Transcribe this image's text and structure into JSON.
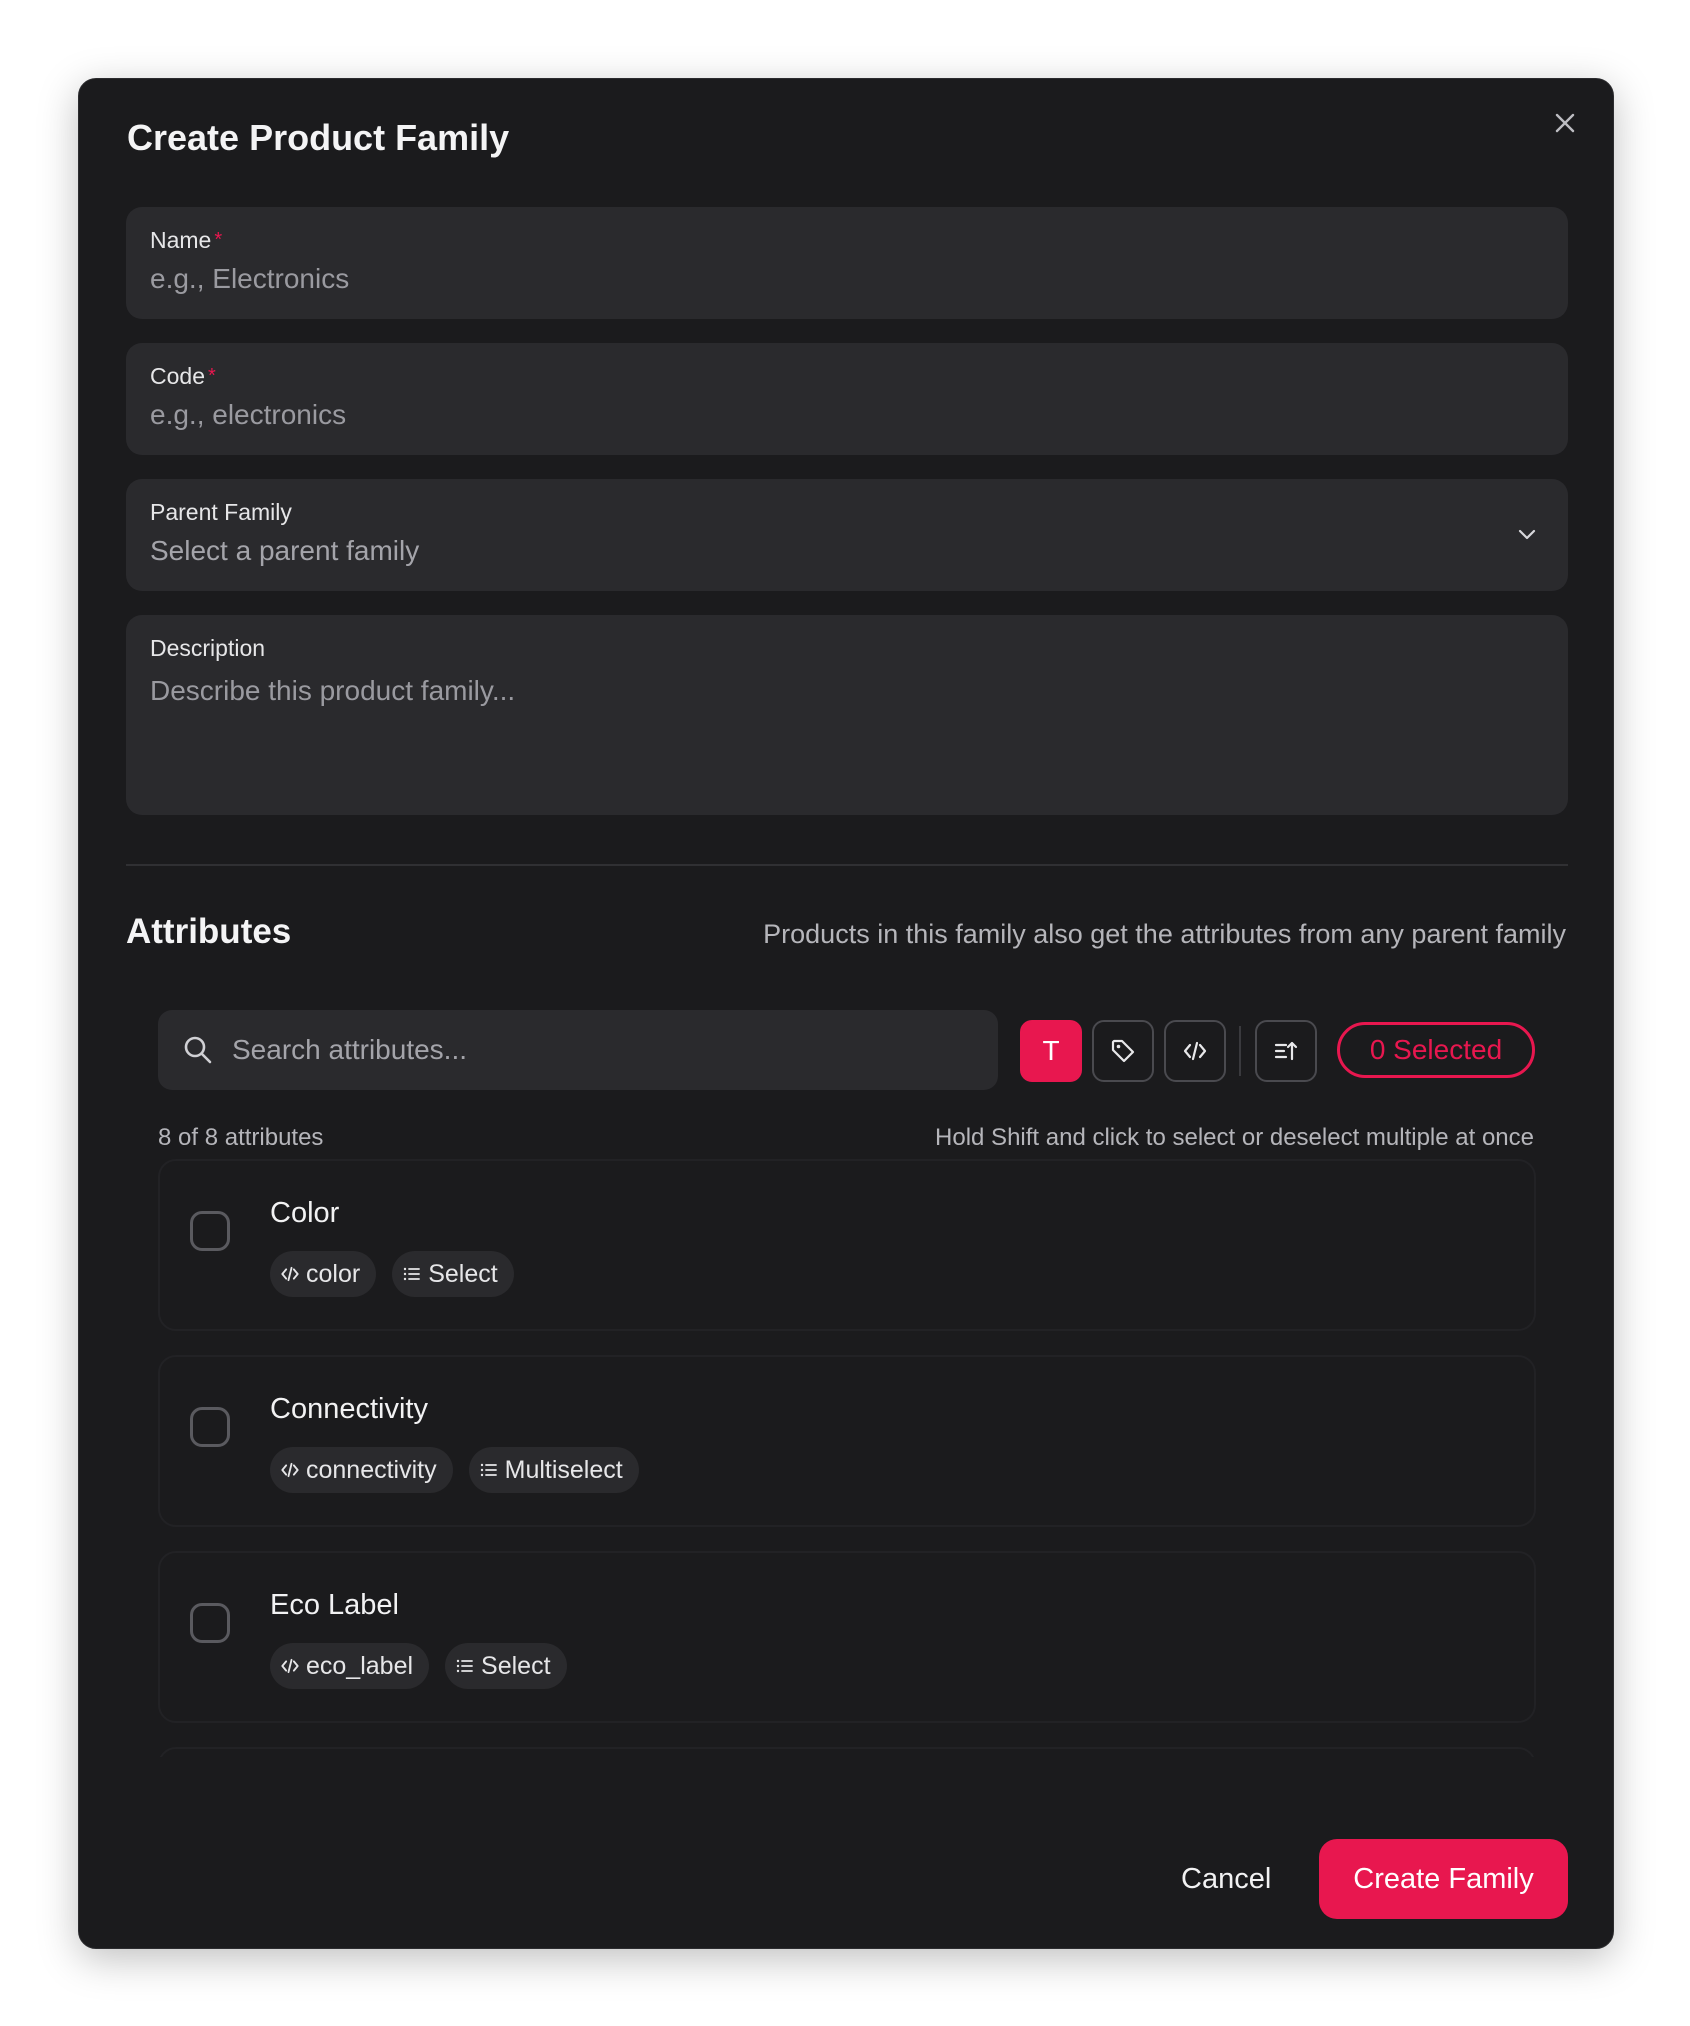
{
  "dialog": {
    "title": "Create Product Family",
    "close_icon": "close-icon"
  },
  "form": {
    "name": {
      "label": "Name",
      "required_mark": "*",
      "placeholder": "e.g., Electronics",
      "value": ""
    },
    "code": {
      "label": "Code",
      "required_mark": "*",
      "placeholder": "e.g., electronics",
      "value": ""
    },
    "parent_family": {
      "label": "Parent Family",
      "placeholder": "Select a parent family",
      "icon": "chevron-down-icon"
    },
    "description": {
      "label": "Description",
      "placeholder": "Describe this product family...",
      "value": ""
    }
  },
  "attributes": {
    "title": "Attributes",
    "hint": "Products in this family also get the attributes from any parent family",
    "search_placeholder": "Search attributes...",
    "search_icon": "search-icon",
    "toolbar": {
      "text_filter_glyph": "T",
      "tag_icon": "tag-icon",
      "code_icon": "code-icon",
      "sort_icon": "sort-icon"
    },
    "selected_label": "0 Selected",
    "count_text": "8 of 8 attributes",
    "shift_hint": "Hold Shift and click to select or deselect multiple at once",
    "items": [
      {
        "name": "Color",
        "code": "color",
        "type": "Select",
        "checked": false
      },
      {
        "name": "Connectivity",
        "code": "connectivity",
        "type": "Multiselect",
        "checked": false
      },
      {
        "name": "Eco Label",
        "code": "eco_label",
        "type": "Select",
        "checked": false
      }
    ]
  },
  "footer": {
    "cancel_label": "Cancel",
    "create_label": "Create Family"
  },
  "colors": {
    "accent": "#e8174f",
    "modal_bg": "#1b1b1d",
    "field_bg": "#2a2a2d"
  }
}
